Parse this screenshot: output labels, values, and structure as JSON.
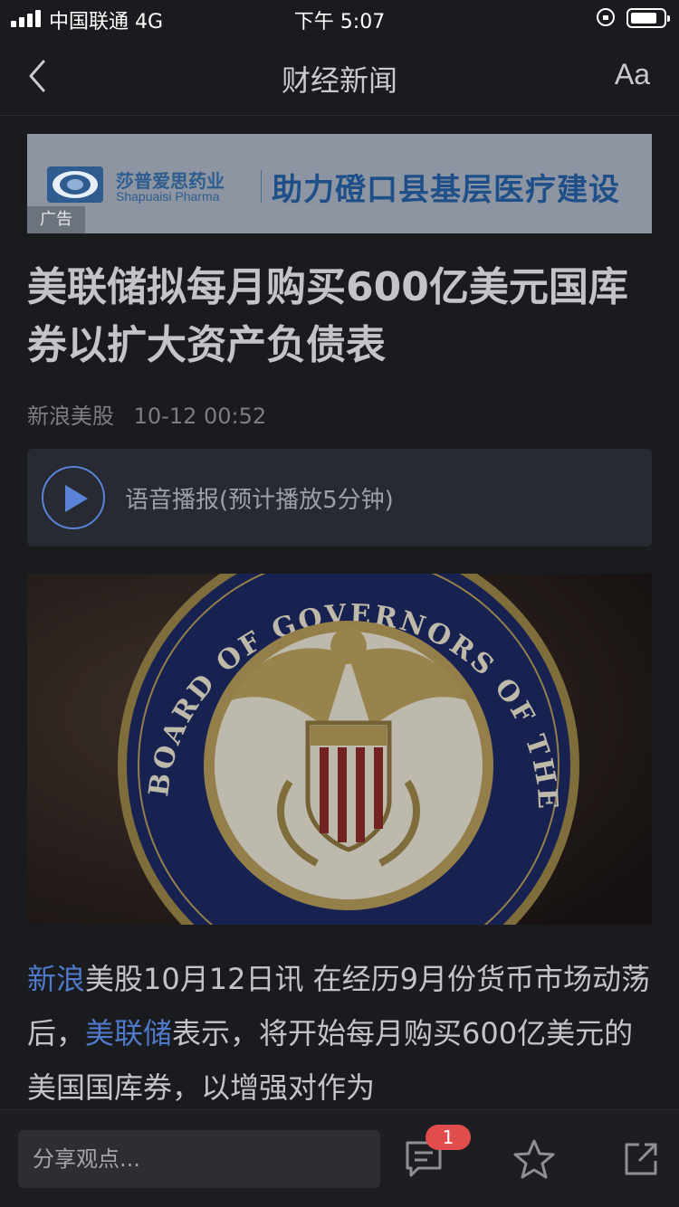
{
  "status_bar": {
    "carrier": "中国联通  4G",
    "time": "下午 5:07"
  },
  "nav": {
    "back_icon": "chevron-left-icon",
    "title": "财经新闻",
    "font_button": "Aa"
  },
  "ad": {
    "brand_cn": "莎普爱思药业",
    "brand_en": "Shapuaisi Pharma",
    "slogan": "助力磴口县基层医疗建设",
    "tag": "广告"
  },
  "article": {
    "title": "美联储拟每月购买600亿美元国库券以扩大资产负债表",
    "source": "新浪美股",
    "datetime": "10-12 00:52",
    "audio_label": "语音播报(预计播放5分钟)",
    "hero_image_text": "BOARD OF GOVERNORS OF THE FEDERAL RESERVE SYSTEM",
    "body": {
      "link1": "新浪",
      "seg1": "美股10月12日讯 在经历9月份货币市场动荡后，",
      "link2": "美联储",
      "seg2": "表示，将开始每月购买600亿美元的美国国库券，以增强对作为"
    }
  },
  "bottom_bar": {
    "comment_placeholder": "分享观点...",
    "comment_count": "1",
    "icons": [
      "comment-icon",
      "star-icon",
      "share-icon"
    ]
  },
  "colors": {
    "background": "#1a1b1f",
    "accent": "#4f79c9",
    "badge": "#e14d4d"
  }
}
